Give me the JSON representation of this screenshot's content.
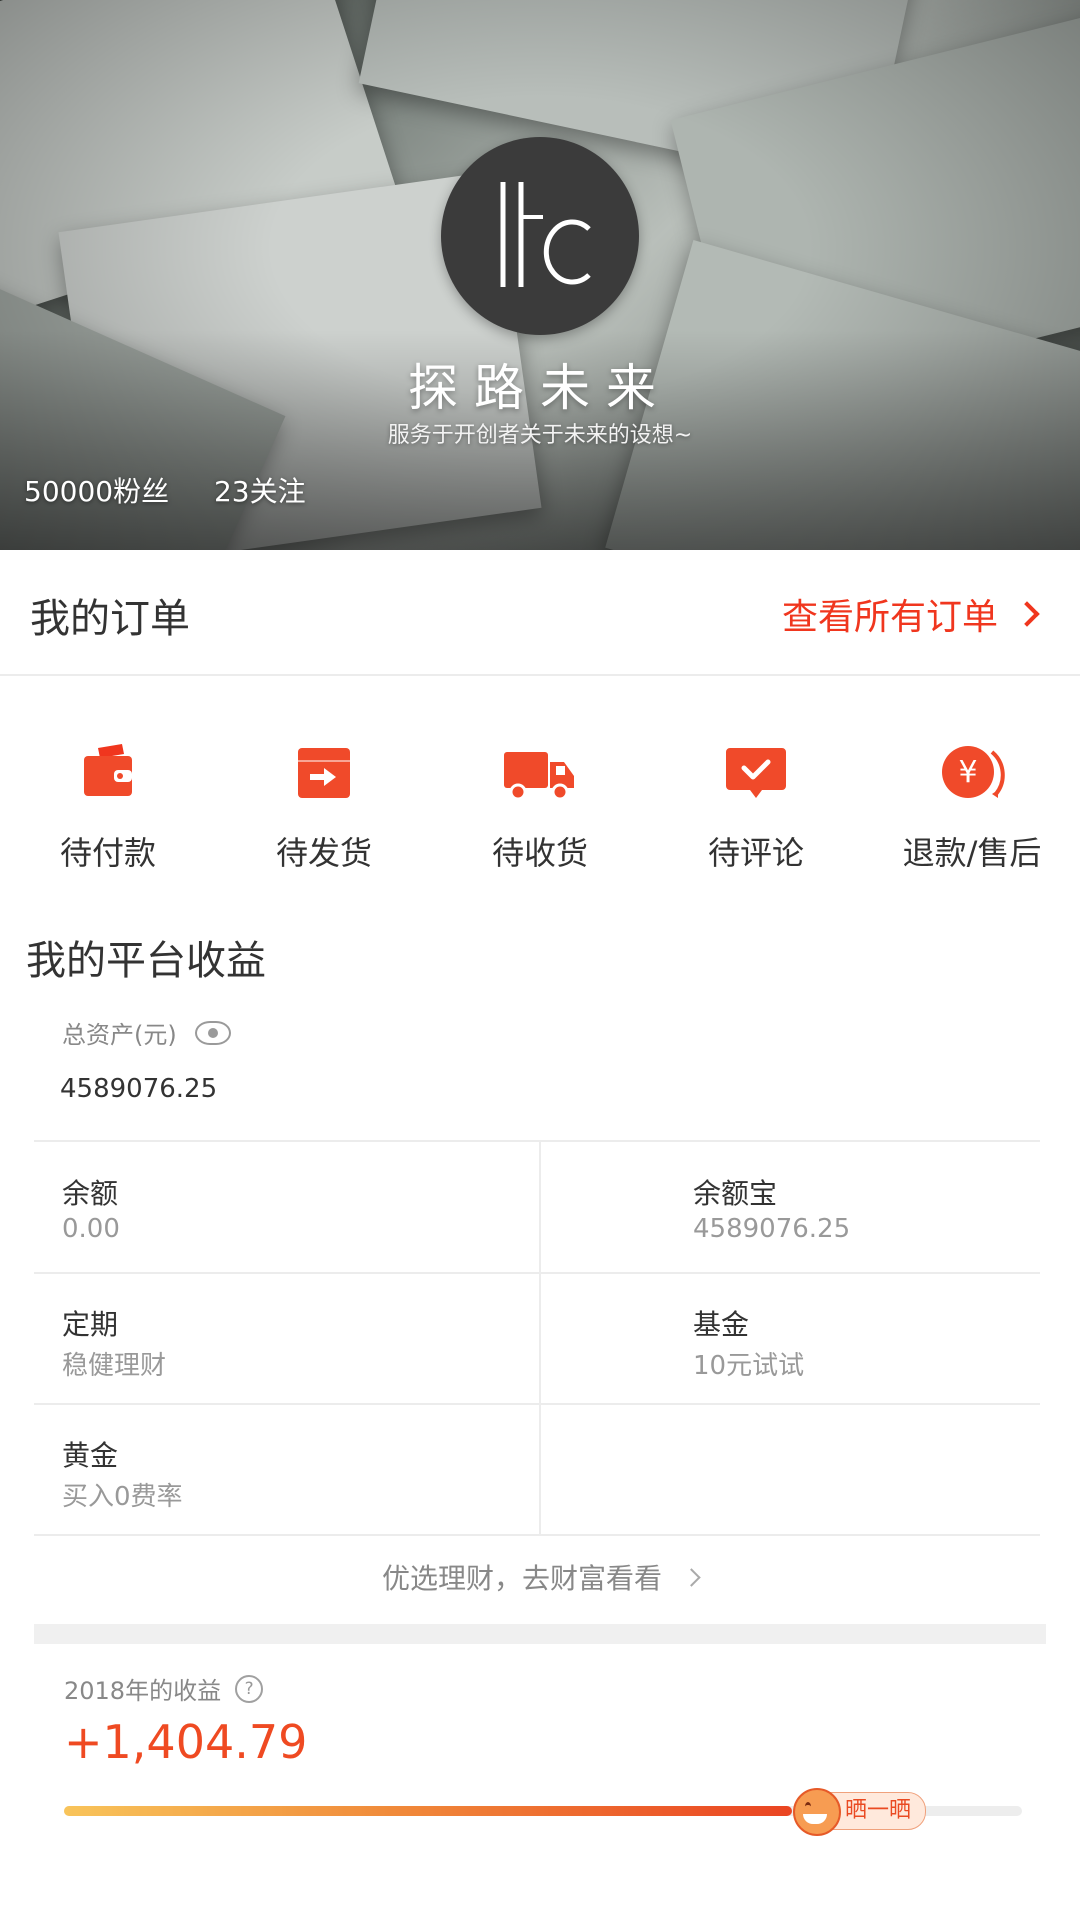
{
  "header": {
    "avatar_text": "ltc",
    "brand_name": "探路未来",
    "brand_subtitle": "服务于开创者关于未来的设想~",
    "followers": "50000粉丝",
    "following": "23关注"
  },
  "orders": {
    "title": "我的订单",
    "view_all": "查看所有订单",
    "items": [
      {
        "label": "待付款",
        "icon": "wallet-icon"
      },
      {
        "label": "待发货",
        "icon": "box-arrow-icon"
      },
      {
        "label": "待收货",
        "icon": "truck-icon"
      },
      {
        "label": "待评论",
        "icon": "comment-check-icon"
      },
      {
        "label": "退款/售后",
        "icon": "yen-refund-icon"
      }
    ],
    "accent_color": "#f0361e"
  },
  "earnings": {
    "title": "我的平台收益",
    "total_assets_label": "总资产(元)",
    "total_assets_value": "4589076.25",
    "cells": [
      {
        "title": "余额",
        "sub": "0.00"
      },
      {
        "title": "余额宝",
        "sub": "4589076.25"
      },
      {
        "title": "定期",
        "sub": "稳健理财"
      },
      {
        "title": "基金",
        "sub": "10元试试"
      },
      {
        "title": "黄金",
        "sub": "买入0费率"
      }
    ],
    "wealth_link": "优选理财，去财富看看",
    "year_label": "2018年的收益",
    "year_value": "+1,404.79",
    "share_label": "晒一晒",
    "progress_fraction": 0.76
  }
}
